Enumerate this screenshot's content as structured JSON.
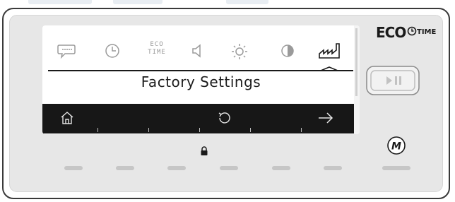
{
  "screen": {
    "title": "Factory Settings"
  },
  "tabs": [
    {
      "id": "messages",
      "icon": "speech-bubble-icon"
    },
    {
      "id": "clock",
      "icon": "clock-icon"
    },
    {
      "id": "eco-time",
      "icon": "eco-time-icon",
      "line1": "ECO",
      "line2": "TIME"
    },
    {
      "id": "volume",
      "icon": "speaker-icon"
    },
    {
      "id": "brightness",
      "icon": "sun-icon"
    },
    {
      "id": "contrast",
      "icon": "contrast-icon"
    },
    {
      "id": "factory",
      "icon": "factory-icon",
      "selected": true
    }
  ],
  "bottom_bar": [
    {
      "id": "home",
      "icon": "home-icon"
    },
    {
      "id": "reset",
      "icon": "reset-icon"
    },
    {
      "id": "next",
      "icon": "arrow-right-icon"
    }
  ],
  "brand": {
    "eco": "ECO",
    "time": "TIME"
  },
  "colors": {
    "lcd_background": "#ffffff",
    "lcd_bar": "#171717",
    "panel_background": "#e7e7e7",
    "indicator_off": "#c6c6c6"
  },
  "buttons": {
    "play_pause": {
      "icon": "play-pause-icon"
    },
    "mode": {
      "label": "M",
      "icon": "m-mode-icon"
    }
  },
  "status": {
    "lock_icon": "lock-icon"
  }
}
